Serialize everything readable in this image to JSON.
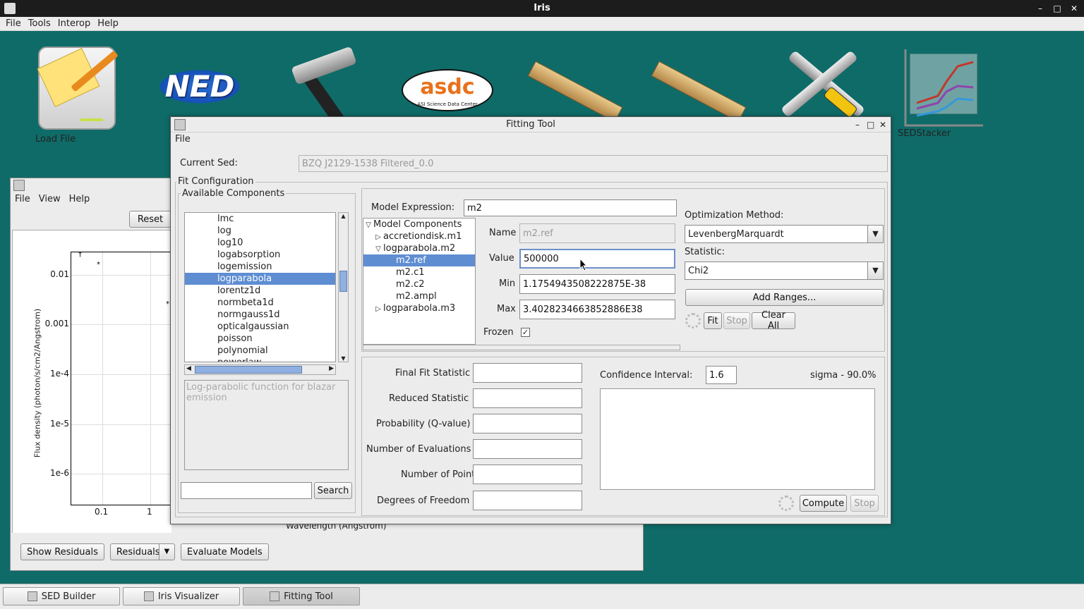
{
  "app": {
    "title": "Iris",
    "menu": [
      "File",
      "Tools",
      "Interop",
      "Help"
    ]
  },
  "desktop": {
    "icons": [
      {
        "label": "Load File",
        "icon": "load-file-icon"
      },
      {
        "label": "",
        "icon": "ned-icon",
        "text": "NED"
      },
      {
        "label": "",
        "icon": "hammer-icon"
      },
      {
        "label": "",
        "icon": "asdc-icon",
        "text": "asdc",
        "subtext": "ASI Science Data Center"
      },
      {
        "label": "",
        "icon": "ruler-icon"
      },
      {
        "label": "",
        "icon": "ruler-icon"
      },
      {
        "label": "",
        "icon": "tools-icon"
      },
      {
        "label": "SEDStacker",
        "icon": "sedstacker-icon"
      }
    ]
  },
  "visualizer": {
    "menu": [
      "File",
      "View",
      "Help"
    ],
    "reset": "Reset",
    "plot": {
      "ylabel": "Flux density (photon/s/cm2/Angstrom)",
      "xlabel": "Wavelength (Angstrom)",
      "yticks": [
        "0.01",
        "0.001",
        "1e-4",
        "1e-5",
        "1e-6"
      ],
      "xticks": [
        "0.1",
        "1"
      ]
    },
    "buttons": {
      "show_residuals": "Show Residuals",
      "residuals": "Residuals",
      "evaluate_models": "Evaluate Models"
    }
  },
  "fitting": {
    "title": "Fitting Tool",
    "menu": "File",
    "current_sed_label": "Current Sed:",
    "current_sed_value": "BZQ J2129-1538 Filtered_0.0",
    "fit_config_label": "Fit Configuration",
    "available_label": "Available Components",
    "components": [
      "lmc",
      "log",
      "log10",
      "logabsorption",
      "logemission",
      "logparabola",
      "lorentz1d",
      "normbeta1d",
      "normgauss1d",
      "opticalgaussian",
      "poisson",
      "polynomial",
      "powerlaw"
    ],
    "selected_component": "logparabola",
    "description": "Log-parabolic function for blazar emission",
    "search_button": "Search",
    "search_value": "",
    "model_expression_label": "Model Expression:",
    "model_expression": "m2",
    "tree": {
      "root": "Model Components",
      "nodes": [
        {
          "label": "accretiondisk.m1",
          "expanded": false,
          "children": []
        },
        {
          "label": "logparabola.m2",
          "expanded": true,
          "children": [
            "m2.ref",
            "m2.c1",
            "m2.c2",
            "m2.ampl"
          ]
        },
        {
          "label": "logparabola.m3",
          "expanded": false,
          "children": []
        }
      ],
      "selected": "m2.ref"
    },
    "param": {
      "name_label": "Name",
      "name": "m2.ref",
      "value_label": "Value",
      "value": "500000",
      "min_label": "Min",
      "min": "1.1754943508222875E-38",
      "max_label": "Max",
      "max": "3.4028234663852886E38",
      "frozen_label": "Frozen",
      "frozen": true
    },
    "optimization_label": "Optimization Method:",
    "optimization_value": "LevenbergMarquardt",
    "statistic_label": "Statistic:",
    "statistic_value": "Chi2",
    "add_ranges": "Add Ranges...",
    "fit": "Fit",
    "stop": "Stop",
    "clear_all": "Clear All",
    "results": {
      "final_fit_statistic": "Final Fit Statistic",
      "reduced_statistic": "Reduced Statistic",
      "probability": "Probability (Q-value)",
      "evaluations": "Number of Evaluations",
      "points": "Number of Points",
      "dof": "Degrees of Freedom"
    },
    "confidence_label": "Confidence Interval:",
    "confidence_value": "1.6",
    "sigma_label": "sigma - 90.0%",
    "compute": "Compute",
    "compute_stop": "Stop"
  },
  "taskbar": [
    "SED Builder",
    "Iris Visualizer",
    "Fitting Tool"
  ],
  "taskbar_active": "Fitting Tool"
}
